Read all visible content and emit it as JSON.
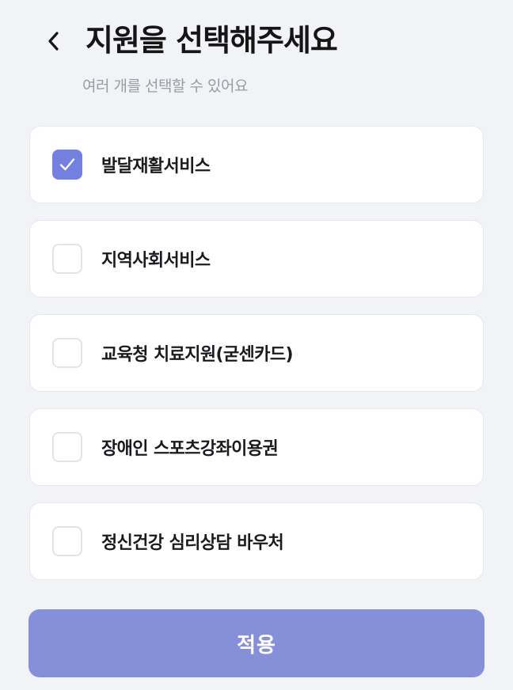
{
  "header": {
    "title": "지원을 선택해주세요",
    "subtitle": "여러 개를 선택할 수 있어요",
    "back_icon": "chevron-left-icon"
  },
  "options": [
    {
      "label": "발달재활서비스",
      "checked": true
    },
    {
      "label": "지역사회서비스",
      "checked": false
    },
    {
      "label": "교육청 치료지원(굳센카드)",
      "checked": false
    },
    {
      "label": "장애인 스포츠강좌이용권",
      "checked": false
    },
    {
      "label": "정신건강 심리상담 바우처",
      "checked": false
    }
  ],
  "footer": {
    "apply_label": "적용"
  },
  "colors": {
    "background": "#F2F3F7",
    "accent": "#7480E0",
    "apply_button": "#8590D9"
  }
}
